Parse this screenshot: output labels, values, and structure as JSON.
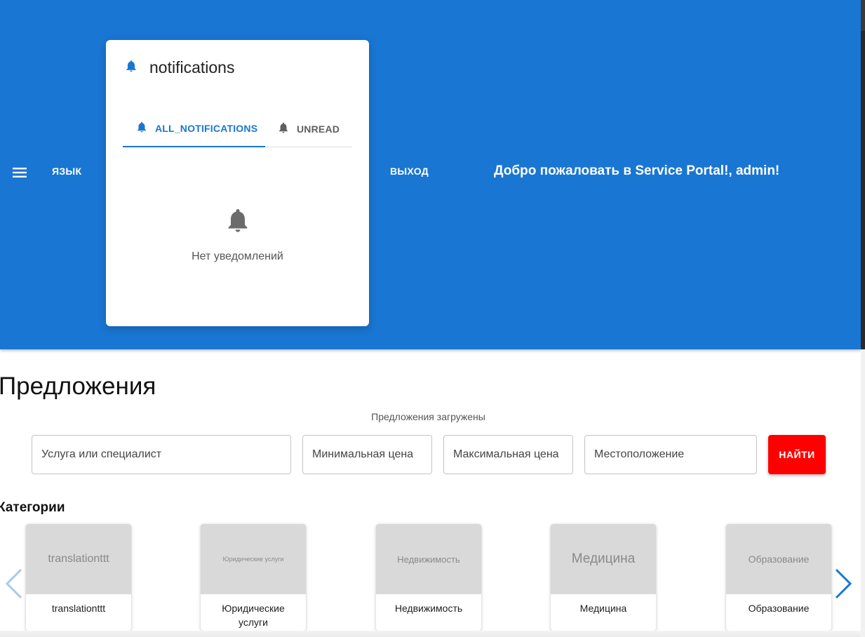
{
  "header": {
    "language_label": "ЯЗЫК",
    "logout_label": "ВЫХОД",
    "welcome_text": "Добро пожаловать в Service Portal!, admin!",
    "background_color": "#1976d2"
  },
  "notifications": {
    "title": "notifications",
    "tabs": [
      {
        "label": "ALL_NOTIFICATIONS",
        "icon": "bell-icon",
        "active": true
      },
      {
        "label": "UNREAD",
        "icon": "bell-icon",
        "active": false
      }
    ],
    "empty_text": "Нет уведомлений",
    "accent_color": "#1976d2"
  },
  "main": {
    "title": "Предложения",
    "status": "Предложения загружены",
    "search": {
      "service_placeholder": "Услуга или специалист",
      "min_price_placeholder": "Минимальная цена",
      "max_price_placeholder": "Максимальная цена",
      "location_placeholder": "Местоположение",
      "button_label": "НАЙТИ",
      "button_color": "#ff0000"
    }
  },
  "categories": {
    "heading": "Категории",
    "items": [
      {
        "image_text": "translationttt",
        "label": "translationttt"
      },
      {
        "image_text": "Юридические услуги",
        "label": "Юридические услуги"
      },
      {
        "image_text": "Недвижимость",
        "label": "Недвижимость"
      },
      {
        "image_text": "Медицина",
        "label": "Медицина"
      },
      {
        "image_text": "Образование",
        "label": "Образование"
      }
    ]
  }
}
